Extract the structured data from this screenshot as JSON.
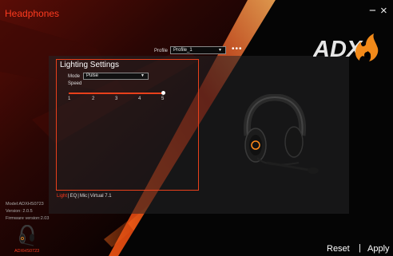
{
  "app": {
    "title": "Headphones"
  },
  "window": {
    "minimize": "−",
    "close": "×"
  },
  "brand": {
    "logo_text": "ADX"
  },
  "profile": {
    "label": "Profile",
    "value": "Profile_1",
    "more": "•••"
  },
  "lighting": {
    "title": "Lighting Settings",
    "mode_label": "Mode",
    "mode_value": "Pulse",
    "speed_label": "Speed",
    "speed_value": 5,
    "ticks": [
      "1",
      "2",
      "3",
      "4",
      "5"
    ]
  },
  "tabs": {
    "light": "Light",
    "eq": "EQ",
    "mic": "Mic",
    "virtual": "Virtual 7.1",
    "separator": "|"
  },
  "device_info": {
    "model": "Model:ADXHS0723",
    "version": "Version: 2.0.5",
    "firmware": "Firmware version:2.03",
    "device_name": "ADXHS0723"
  },
  "footer": {
    "reset": "Reset",
    "separator": "|",
    "apply": "Apply"
  },
  "colors": {
    "accent": "#e8401b",
    "title": "#ff3b1f",
    "background": "#000000"
  },
  "icons": {
    "minimize": "minimize-icon",
    "close": "close-icon",
    "dropdown": "chevron-down-icon",
    "more": "more-icon"
  }
}
